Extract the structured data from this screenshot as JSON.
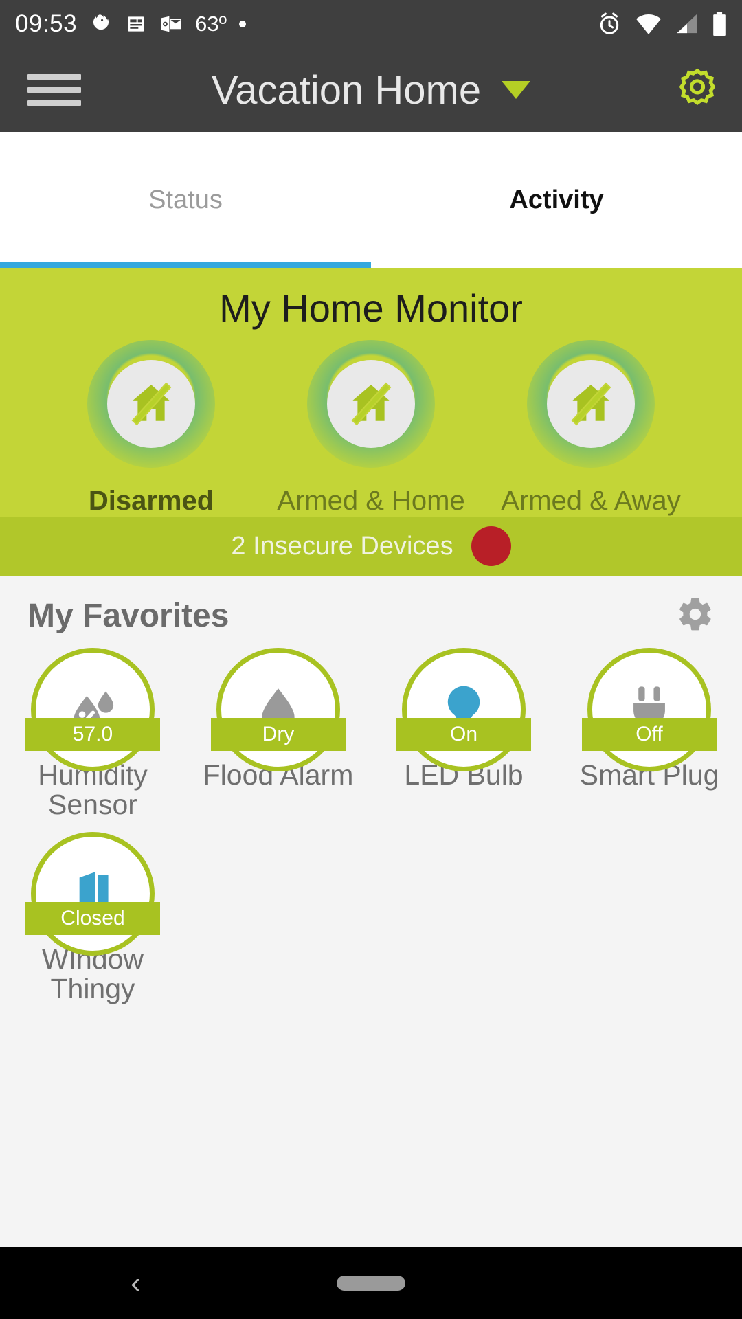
{
  "status_bar": {
    "time": "09:53",
    "temperature": "63º",
    "icons_left": [
      "firefox-icon",
      "news-icon",
      "outlook-icon",
      "dot-icon"
    ],
    "icons_right": [
      "alarm-icon",
      "wifi-icon",
      "cellular-signal-icon",
      "battery-icon"
    ]
  },
  "app_bar": {
    "menu_icon": "hamburger-menu-icon",
    "title": "Vacation Home",
    "dropdown_icon": "caret-down-icon",
    "settings_icon": "gear-icon",
    "accent": "#b5cf25",
    "background": "#3f3f3f"
  },
  "tabs": {
    "items": [
      {
        "label": "Status",
        "active": false
      },
      {
        "label": "Activity",
        "active": true
      }
    ],
    "indicator_color": "#35a8dd"
  },
  "monitor": {
    "title": "My Home Monitor",
    "background": "#c3d537",
    "modes": [
      {
        "label": "Disarmed",
        "icon": "house-slash-icon",
        "selected": true
      },
      {
        "label": "Armed & Home",
        "icon": "house-slash-icon",
        "selected": false
      },
      {
        "label": "Armed & Away",
        "icon": "house-slash-icon",
        "selected": false
      }
    ],
    "insecure_banner": {
      "text": "2 Insecure Devices",
      "badge_icon": "alert-dot-icon",
      "badge_color": "#b81f27",
      "background": "#b1c72a"
    }
  },
  "favorites": {
    "title": "My Favorites",
    "settings_icon": "gear-icon",
    "accent": "#a8c221",
    "devices": [
      {
        "name": "Humidity Sensor",
        "status": "57.0",
        "icon": "humidity-drops-percent-icon",
        "icon_color": "#9a9a9a"
      },
      {
        "name": "Flood Alarm",
        "status": "Dry",
        "icon": "water-drop-icon",
        "icon_color": "#9a9a9a"
      },
      {
        "name": "LED Bulb",
        "status": "On",
        "icon": "light-bulb-icon",
        "icon_color": "#3ba3cd"
      },
      {
        "name": "Smart Plug",
        "status": "Off",
        "icon": "power-plug-icon",
        "icon_color": "#9a9a9a"
      },
      {
        "name": "WIndow Thingy",
        "status": "Closed",
        "icon": "window-open-icon",
        "icon_color": "#3ba3cd"
      }
    ]
  },
  "nav_bar": {
    "back_icon": "back-chevron-icon",
    "home_pill_icon": "home-pill-icon"
  }
}
